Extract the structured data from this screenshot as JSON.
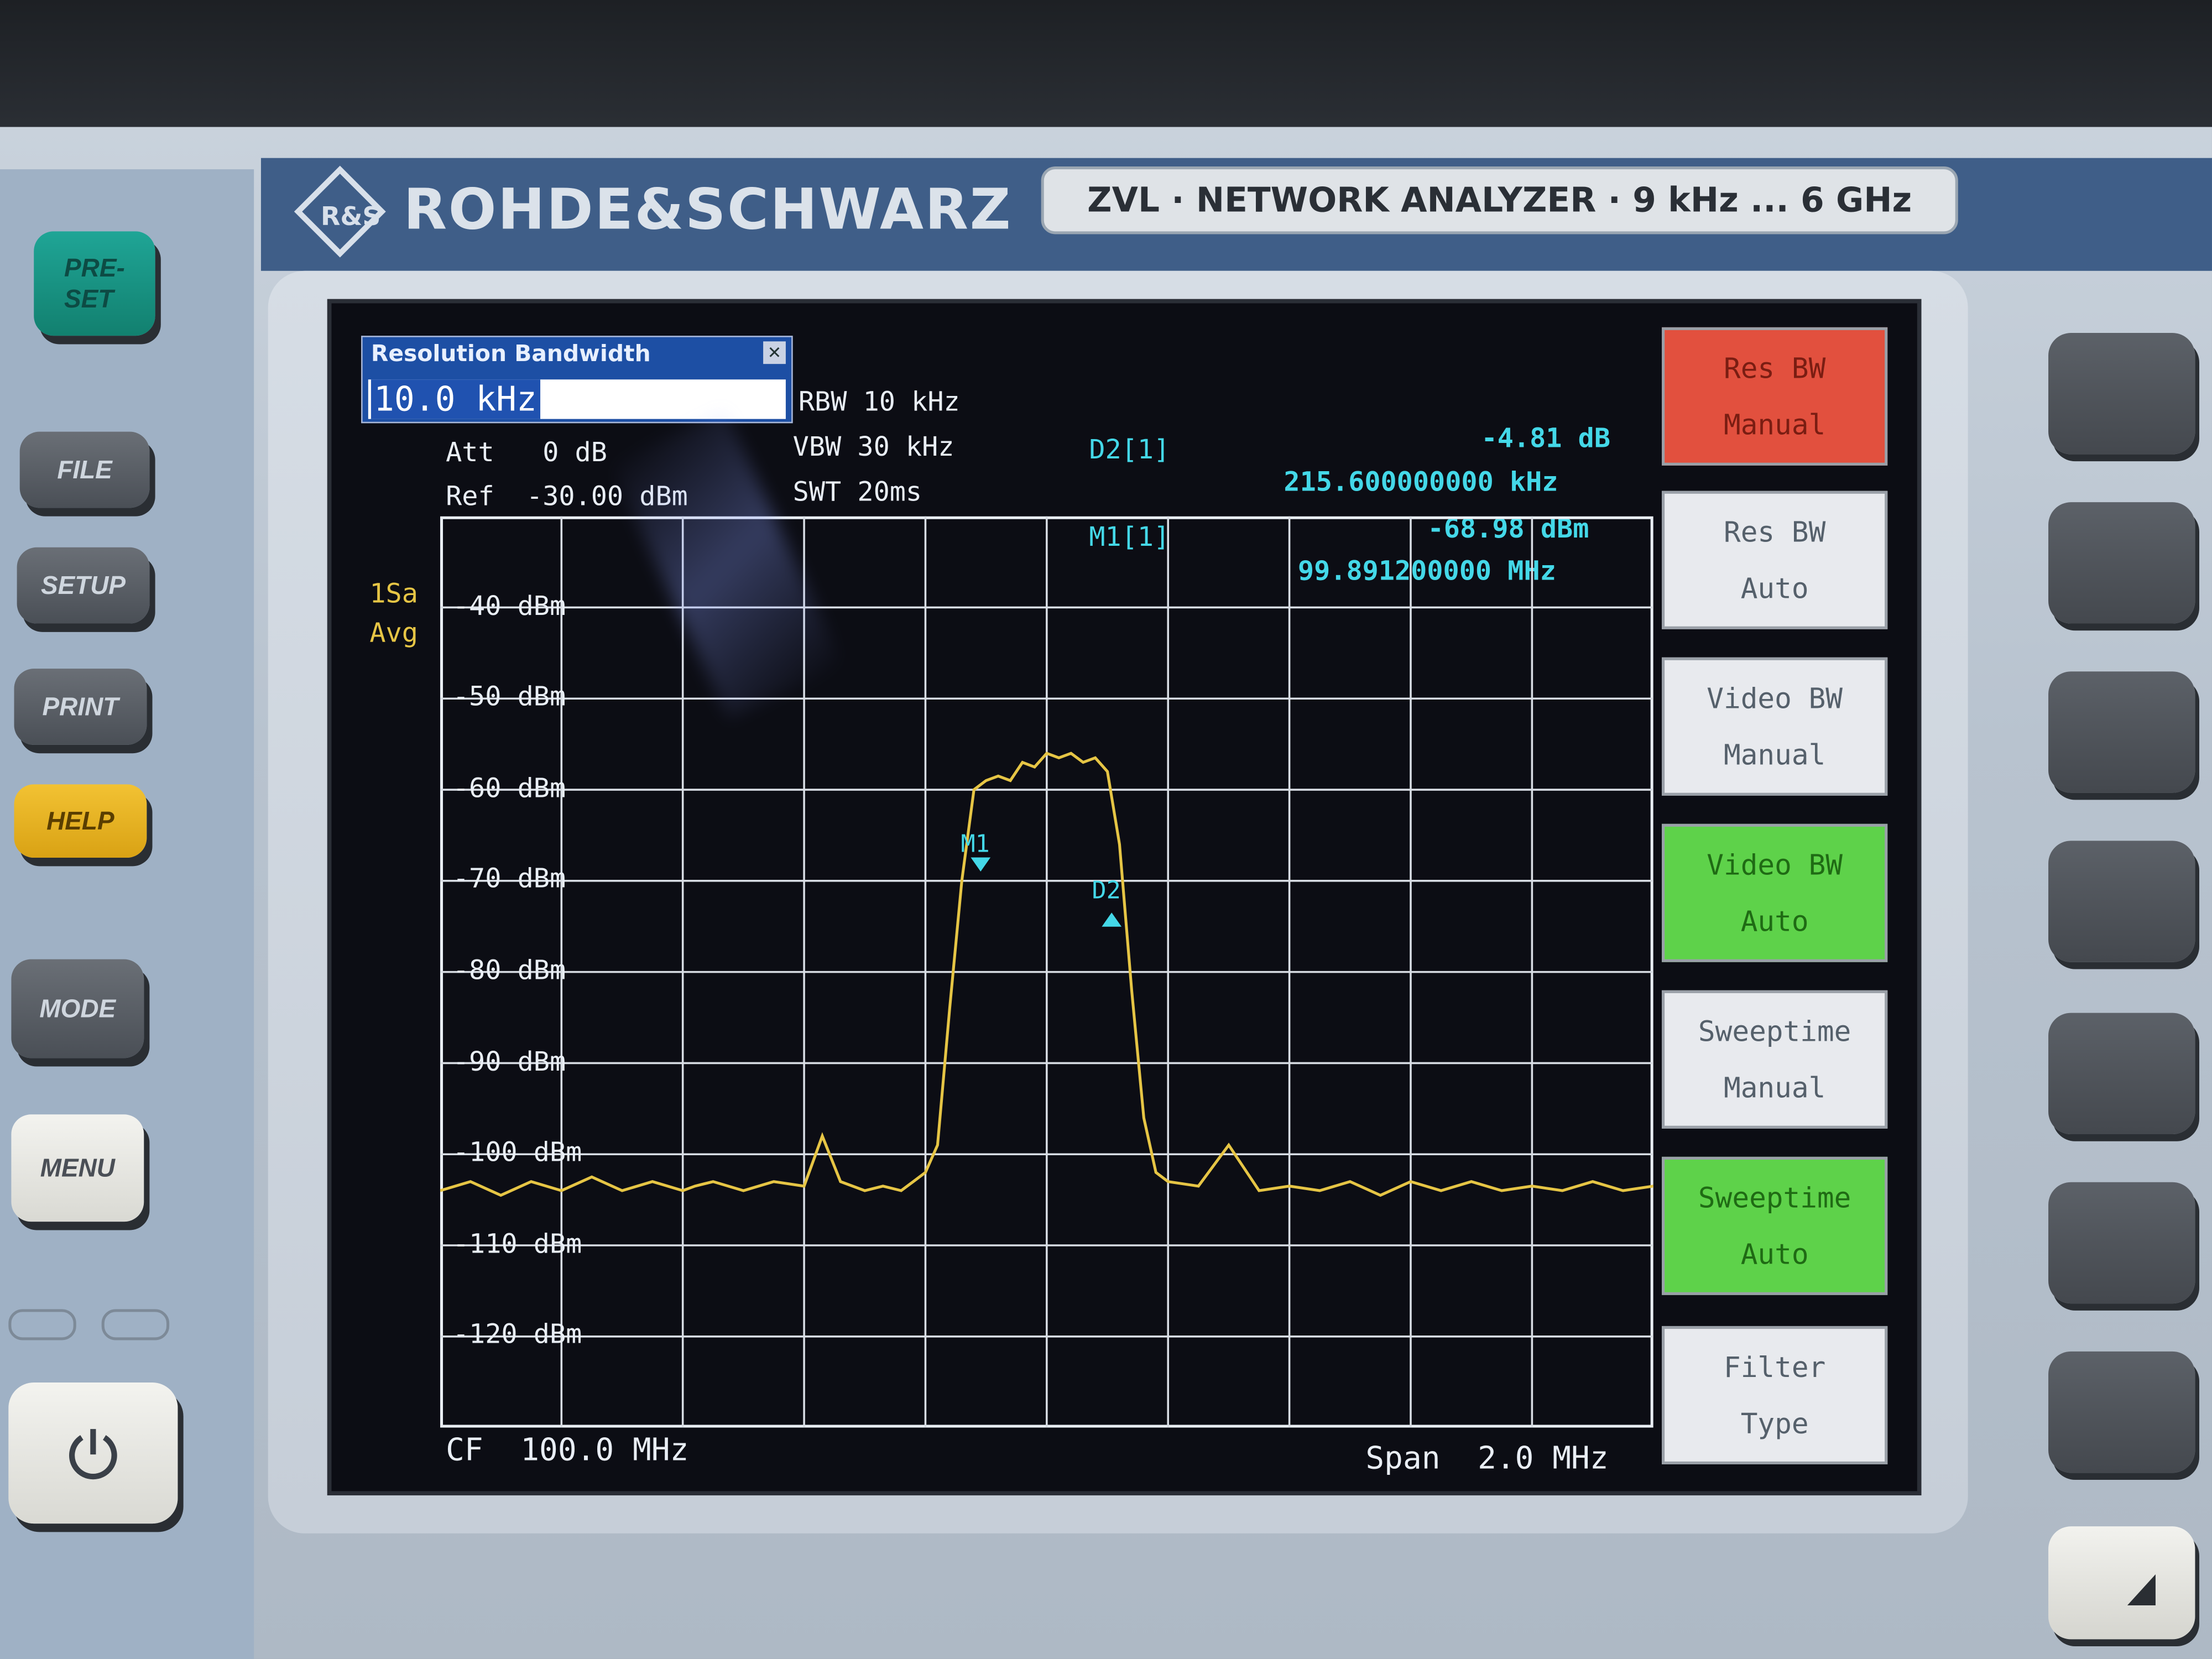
{
  "brand": "ROHDE&SCHWARZ",
  "logo_text": "R&S",
  "model_label": "ZVL  ·  NETWORK ANALYZER  ·  9 kHz ... 6 GHz",
  "left_buttons": {
    "preset": "PRE-\nSET",
    "file": "FILE",
    "setup": "SETUP",
    "print": "PRINT",
    "help": "HELP",
    "mode": "MODE",
    "menu": "MENU",
    "power_icon": "power-icon"
  },
  "dialog": {
    "title": "Resolution Bandwidth",
    "value": "10.0 kHz",
    "close": "✕"
  },
  "settings": {
    "rbw": "RBW 10 kHz",
    "vbw": "VBW 30 kHz",
    "swt": "SWT 20ms",
    "att": "Att   0 dB",
    "ref": "Ref  -30.00 dBm"
  },
  "trace_mode": {
    "line1": "1Sa",
    "line2": "Avg"
  },
  "markers": {
    "d2_label": "D2[1]",
    "d2_level": "-4.81 dB",
    "d2_freq": "215.600000000 kHz",
    "m1_label": "M1[1]",
    "m1_level": "-68.98 dBm",
    "m1_freq": "99.891200000 MHz"
  },
  "footer": {
    "cf": "CF  100.0 MHz",
    "span": "Span  2.0 MHz"
  },
  "softkeys": [
    {
      "line1": "Res BW",
      "line2": "Manual",
      "state": "active",
      "color": "#e2503e"
    },
    {
      "line1": "Res BW",
      "line2": "Auto",
      "state": "normal",
      "color": "#e8eaee"
    },
    {
      "line1": "Video BW",
      "line2": "Manual",
      "state": "normal",
      "color": "#e8eaee"
    },
    {
      "line1": "Video BW",
      "line2": "Auto",
      "state": "selected",
      "color": "#5ed24a"
    },
    {
      "line1": "Sweeptime",
      "line2": "Manual",
      "state": "normal",
      "color": "#e8eaee"
    },
    {
      "line1": "Sweeptime",
      "line2": "Auto",
      "state": "selected",
      "color": "#5ed24a"
    },
    {
      "line1": "Filter",
      "line2": "Type",
      "state": "normal",
      "color": "#e8eaee"
    }
  ],
  "chart_data": {
    "type": "line",
    "y_tick_labels": [
      "-40 dBm",
      "-50 dBm",
      "-60 dBm",
      "-70 dBm",
      "-80 dBm",
      "-90 dBm",
      "-100 dBm",
      "-110 dBm",
      "-120 dBm"
    ],
    "ylim": [
      -130,
      -30
    ],
    "xlim_mhz": [
      99.0,
      101.0
    ],
    "grid": true,
    "trace_color": "#e6c545",
    "series": [
      {
        "x": [
          99.0,
          99.05,
          99.1,
          99.15,
          99.2,
          99.25,
          99.3,
          99.35,
          99.4,
          99.42,
          99.45,
          99.5,
          99.55,
          99.6,
          99.63,
          99.66,
          99.7,
          99.73,
          99.76,
          99.78,
          99.8,
          99.82,
          99.84,
          99.86,
          99.88,
          99.9,
          99.92,
          99.94,
          99.96,
          99.98,
          100.0,
          100.02,
          100.04,
          100.06,
          100.08,
          100.1,
          100.12,
          100.14,
          100.16,
          100.18,
          100.2,
          100.25,
          100.3,
          100.35,
          100.4,
          100.45,
          100.5,
          100.55,
          100.6,
          100.65,
          100.7,
          100.75,
          100.8,
          100.85,
          100.9,
          100.95,
          101.0
        ],
        "y": [
          -104,
          -103,
          -104.5,
          -103,
          -104,
          -102.5,
          -104,
          -103,
          -104,
          -103.5,
          -103,
          -104,
          -103,
          -103.5,
          -98,
          -103,
          -104,
          -103.5,
          -104,
          -103,
          -102,
          -99,
          -84,
          -70,
          -60,
          -59,
          -58.5,
          -59,
          -57,
          -57.5,
          -56,
          -56.5,
          -56,
          -57,
          -56.5,
          -58,
          -66,
          -82,
          -96,
          -102,
          -103,
          -103.5,
          -99,
          -104,
          -103.5,
          -104,
          -103,
          -104.5,
          -103,
          -104,
          -103,
          -104,
          -103.5,
          -104,
          -103,
          -104,
          -103.5
        ]
      }
    ],
    "marker_labels": [
      "M1",
      "D2"
    ],
    "markers": [
      {
        "name": "M1",
        "x": 99.891,
        "y": -68.98
      },
      {
        "name": "D2",
        "x": 100.107,
        "y": -73.79
      }
    ]
  }
}
